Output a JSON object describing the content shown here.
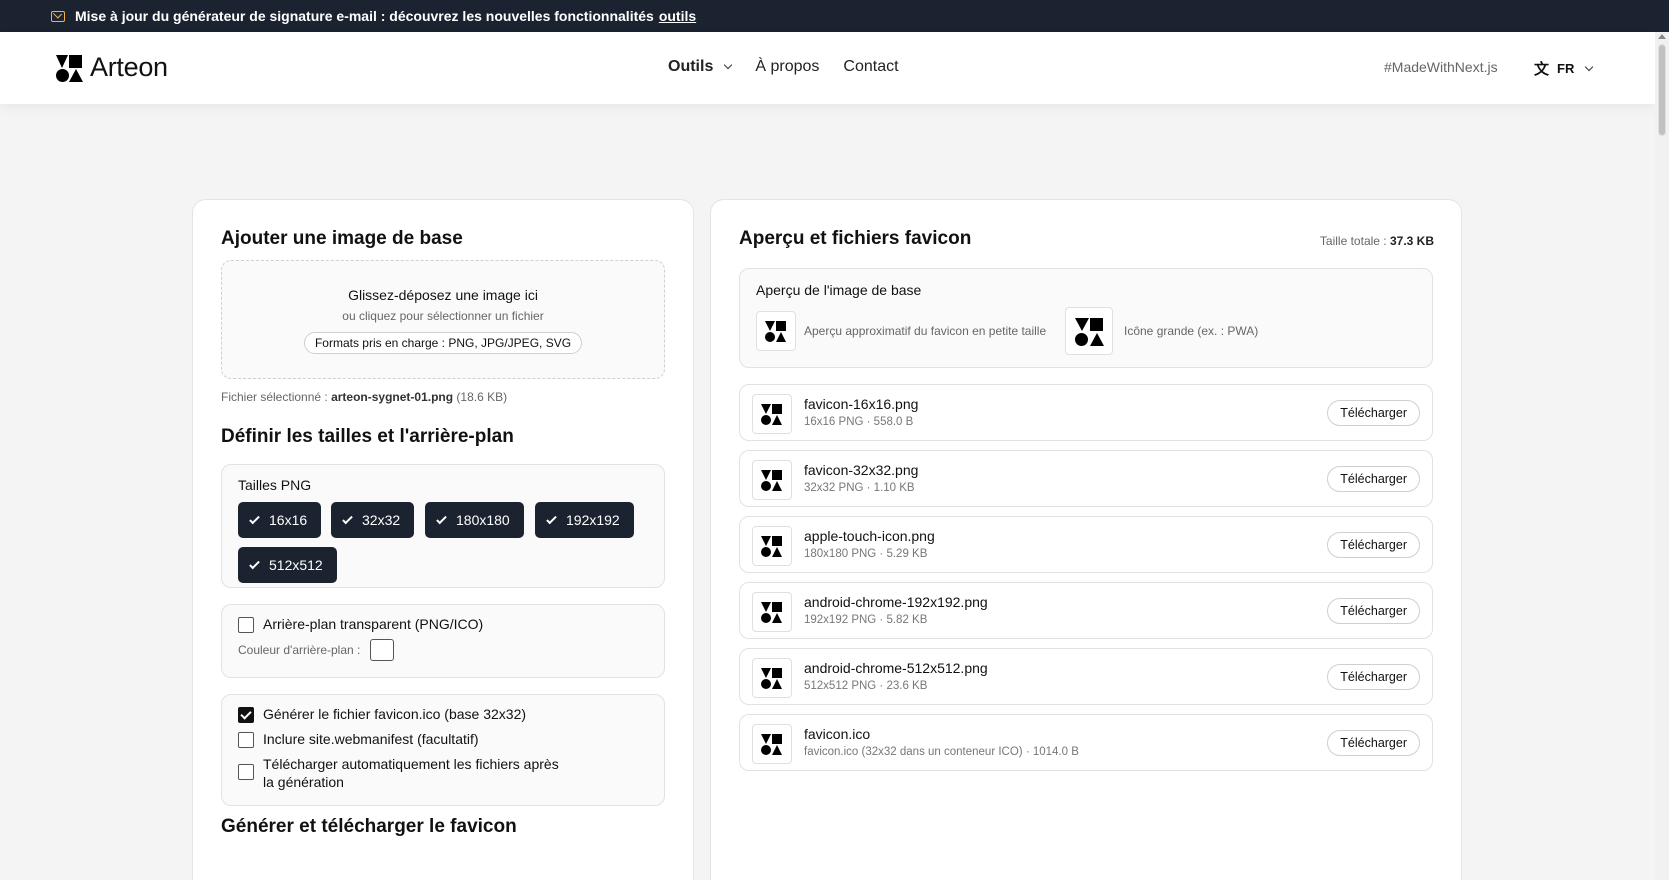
{
  "announcement": {
    "icon": "mail-icon",
    "text": "Mise à jour du générateur de signature e-mail : découvrez les nouvelles fonctionnalités",
    "link": "outils"
  },
  "header": {
    "brand": "Arteon",
    "nav": [
      {
        "label": "Outils",
        "has_dropdown": true
      },
      {
        "label": "À propos"
      },
      {
        "label": "Contact"
      }
    ],
    "made_with": "#MadeWithNext.js",
    "lang": "FR"
  },
  "left": {
    "add_title": "Ajouter une image de base",
    "dropzone": {
      "title": "Glissez-déposez une image ici",
      "subtitle": "ou cliquez pour sélectionner un fichier",
      "formats": "Formats pris en charge : PNG, JPG/JPEG, SVG"
    },
    "selected_prefix": "Fichier sélectionné :",
    "selected_name": "arteon-sygnet-01.png",
    "selected_size": "(18.6 KB)",
    "sizes_title": "Définir les tailles et l'arrière-plan",
    "sizes_label": "Tailles PNG",
    "sizes": [
      "16x16",
      "32x32",
      "180x180",
      "192x192",
      "512x512"
    ],
    "transparent_label": "Arrière-plan transparent (PNG/ICO)",
    "transparent_checked": false,
    "bg_color_label": "Couleur d'arrière-plan :",
    "options": [
      {
        "label": "Générer le fichier favicon.ico (base 32x32)",
        "checked": true
      },
      {
        "label": "Inclure site.webmanifest (facultatif)",
        "checked": false
      },
      {
        "label": "Télécharger automatiquement les fichiers après la génération",
        "checked": false
      }
    ],
    "generate_title": "Générer et télécharger le favicon"
  },
  "right": {
    "title": "Aperçu et fichiers favicon",
    "total_label": "Taille totale :",
    "total_value": "37.3 KB",
    "preview_title": "Aperçu de l'image de base",
    "preview_small_caption": "Aperçu approximatif du favicon en petite taille",
    "preview_large_caption": "Icône grande (ex. : PWA)",
    "download_label": "Télécharger",
    "files": [
      {
        "name": "favicon-16x16.png",
        "meta": "16x16 PNG · 558.0 B"
      },
      {
        "name": "favicon-32x32.png",
        "meta": "32x32 PNG · 1.10 KB"
      },
      {
        "name": "apple-touch-icon.png",
        "meta": "180x180 PNG · 5.29 KB"
      },
      {
        "name": "android-chrome-192x192.png",
        "meta": "192x192 PNG · 5.82 KB"
      },
      {
        "name": "android-chrome-512x512.png",
        "meta": "512x512 PNG · 23.6 KB"
      },
      {
        "name": "favicon.ico",
        "meta": "favicon.ico (32x32 dans un conteneur ICO) · 1014.0 B"
      }
    ]
  }
}
